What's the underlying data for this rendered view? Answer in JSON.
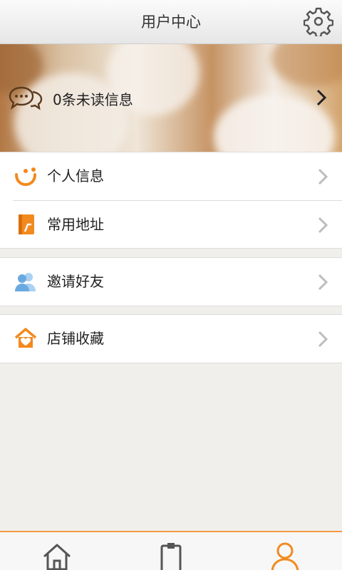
{
  "header": {
    "title": "用户中心",
    "settings_icon": "gear-icon"
  },
  "banner": {
    "messages_label": "0条未读信息",
    "icon": "chat-bubbles-icon"
  },
  "menu_groups": [
    {
      "items": [
        {
          "label": "个人信息",
          "icon": "smile-icon"
        },
        {
          "label": "常用地址",
          "icon": "address-book-icon"
        }
      ]
    },
    {
      "items": [
        {
          "label": "邀请好友",
          "icon": "people-icon"
        }
      ]
    },
    {
      "items": [
        {
          "label": "店铺收藏",
          "icon": "heart-house-icon"
        }
      ]
    }
  ],
  "tabbar": {
    "tabs": [
      {
        "icon": "home-icon",
        "active": false
      },
      {
        "icon": "clipboard-icon",
        "active": false
      },
      {
        "icon": "user-icon",
        "active": true
      }
    ]
  },
  "colors": {
    "accent": "#f39a45",
    "orange": "#f28a1f",
    "blue": "#7ab6e8"
  }
}
